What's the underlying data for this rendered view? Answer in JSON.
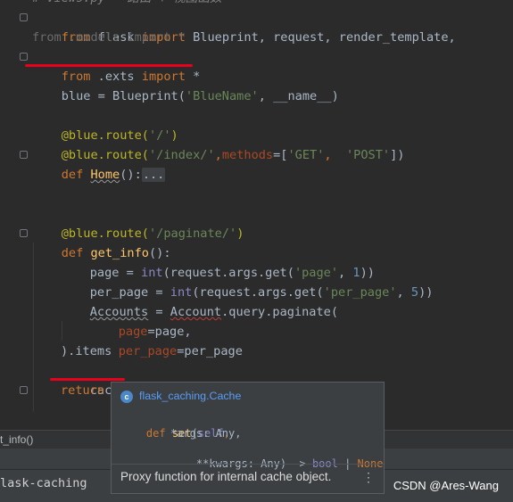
{
  "code": {
    "header_fragment": "# views.py — 路由 + 视图函数",
    "import1": {
      "from_kw": "from",
      "module": " flask ",
      "import_kw": "import",
      "names": " Blueprint, request, render_template,"
    },
    "import2": "from .models import *",
    "import3": {
      "from_kw": "from",
      "module": " .exts ",
      "import_kw": "import",
      "rest": " *"
    },
    "bp_line": {
      "lhs": "blue = Blueprint(",
      "s1": "'BlueName'",
      "mid": ", __name__)"
    },
    "route1": {
      "dec": "@blue.route(",
      "arg": "'/'",
      "close": ")"
    },
    "route2": {
      "dec": "@blue.route(",
      "arg": "'/index/'",
      "comma": ",",
      "kw": "methods",
      "eq": "=[",
      "a": "'GET'",
      "sep": ",  ",
      "b": "'POST'",
      "close": "])"
    },
    "def_home": {
      "def_kw": "def",
      "name": "Home",
      "parens": "():",
      "fold": "..."
    },
    "route3": {
      "dec": "@blue.route(",
      "arg": "'/paginate/'",
      "close": ")"
    },
    "def_info": {
      "def_kw": "def",
      "name": "get_info",
      "parens": "():"
    },
    "page_line": {
      "a": "page = ",
      "b": "int",
      "c": "(request.args.get(",
      "d": "'page'",
      "e": ", ",
      "f": "1",
      "g": "))"
    },
    "per_page_line": {
      "a": "per_page = ",
      "b": "int",
      "c": "(request.args.get(",
      "d": "'per_page'",
      "e": ", ",
      "f": "5",
      "g": "))"
    },
    "accounts_line": {
      "a": "Accounts",
      "b": " = ",
      "c": "Account",
      "d": ".query.paginate("
    },
    "arg_page": {
      "kw": "page",
      "rest": "=page,"
    },
    "arg_per_page": {
      "kw": "per_page",
      "rest": "=per_page"
    },
    "items_line": ").items",
    "cache_line": {
      "a": "cache.set",
      "b": "()"
    },
    "return_line": "return"
  },
  "popup": {
    "header": "flask_caching.Cache",
    "icon_letter": "c",
    "sig1": {
      "def_kw": "def ",
      "name": "set",
      "open": "(",
      "self": "self",
      "comma": ","
    },
    "sig2": "*args: Any,",
    "sig3": {
      "a": "**kwargs: Any) -> ",
      "b": "bool",
      "c": " | ",
      "d": "None"
    },
    "doc": "Proxy function for internal cache object.",
    "more": "⋮"
  },
  "breadcrumb": "t_info()",
  "module_text": "lask-caching",
  "watermark": "CSDN @Ares-Wang",
  "colors": {
    "accent_red": "#e8001c",
    "link_blue": "#589df6",
    "background": "#2b2b2b"
  },
  "icons": [
    "fold-icon",
    "class-icon",
    "more-icon"
  ]
}
